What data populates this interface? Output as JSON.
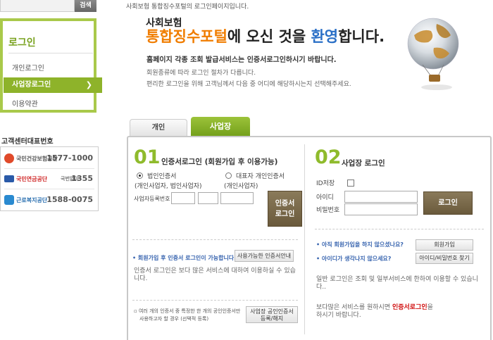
{
  "search": {
    "button": "검색"
  },
  "sidebar": {
    "title": "로그인",
    "items": [
      {
        "label": "개인로그인"
      },
      {
        "label": "사업장로그인",
        "active": true
      },
      {
        "label": "이용약관"
      }
    ]
  },
  "callcenter": {
    "title": "고객센터대표번호",
    "rows": [
      {
        "name": "국민건강보험공단",
        "phone": "1577-1000"
      },
      {
        "name": "국민연금공단",
        "note": "국번없이",
        "phone": "1355"
      },
      {
        "name": "근로복지공단",
        "phone": "1588-0075"
      }
    ]
  },
  "header": {
    "intro": "사회보험 통합징수포털의 로그인페이지입니다.",
    "line1": "사회보험",
    "line2_orange": "통합징수포털",
    "line2_mid": "에 오신 것을 ",
    "line2_blue": "환영",
    "line2_end": "합니다.",
    "desc1": "홈페이지 각종 조회 발급서비스는 인증서로그인하시기 바랍니다.",
    "desc2": "회원종류에 따라 로그인 절차가 다릅니다.",
    "desc3": "편리한 로그인을 위해 고객님께서 다음 중 어디에 해당하시는지 선택해주세요."
  },
  "tabs": [
    {
      "label": "개인",
      "active": false
    },
    {
      "label": "사업장",
      "active": true
    }
  ],
  "cert": {
    "num": "01",
    "title": "인증서로그인 (회원가입 후 이용가능)",
    "radio1": "법인인증서",
    "radio1_sub": "(개인사업자, 법인사업자)",
    "radio2": "대표자 개인인증서",
    "radio2_sub": "(개인사업자)",
    "biz_label": "사업자등록번호",
    "login_btn_line1": "인증서",
    "login_btn_line2": "로그인",
    "note": "회원가입 후 인증서 로그인이 가능합니다.",
    "guide_btn": "사용가능한 인증서안내",
    "body": "인증서 로그인은 보다 많은 서비스에 대하여 이용하실 수 있습니다.",
    "multi_note_1": "여러 개의 인증서 중 특정한 한 개의 공인인증서만",
    "multi_note_2": "사용하고자 할 경우 (선택적 등록)",
    "reg_btn_1": "사업장 공인인증서",
    "reg_btn_2": "등록/해지"
  },
  "biz": {
    "num": "02",
    "title": "사업장 로그인",
    "id_save": "ID저장",
    "id_label": "아이디",
    "pw_label": "비밀번호",
    "login_btn": "로그인",
    "q1": "아직 회원가입을 하지 않으셨나요?",
    "join_btn": "회원가입",
    "q2": "아이디가 생각나지 않으세요?",
    "find_btn": "아이디/비밀번호 찾기",
    "body1": "일반 로그인은 조회 및 일부서비스에 한하여 이용할 수 있습니다..",
    "body2_pre": "보다많은 서비스를 원하시면 ",
    "body2_red": "인증서로그인",
    "body2_post": "을",
    "body2_line2": "하시기 바랍니다."
  },
  "colors": {
    "green": "#8eb32a",
    "orange": "#f07d00",
    "blue": "#2a6fc6",
    "brown": "#6a5a3c"
  }
}
